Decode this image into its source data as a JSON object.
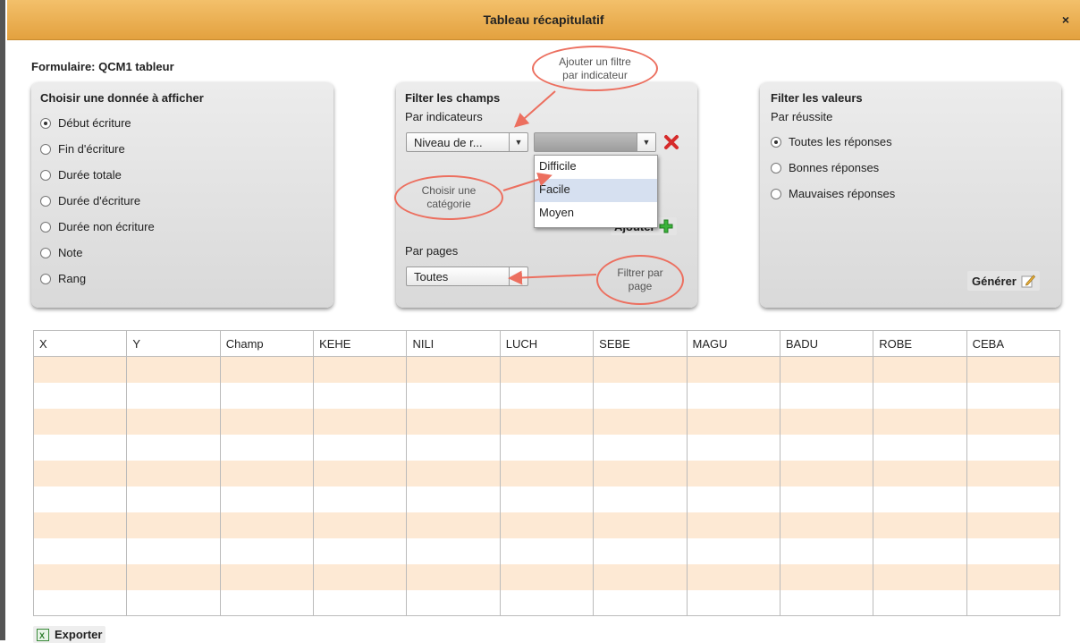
{
  "window": {
    "title": "Tableau récapitulatif",
    "close": "×"
  },
  "form_label": "Formulaire: QCM1 tableur",
  "data_panel": {
    "title": "Choisir une donnée à afficher",
    "options": [
      {
        "label": "Début écriture",
        "selected": true
      },
      {
        "label": "Fin d'écriture",
        "selected": false
      },
      {
        "label": "Durée totale",
        "selected": false
      },
      {
        "label": "Durée d'écriture",
        "selected": false
      },
      {
        "label": "Durée non écriture",
        "selected": false
      },
      {
        "label": "Note",
        "selected": false
      },
      {
        "label": "Rang",
        "selected": false
      }
    ]
  },
  "fields_panel": {
    "title": "Filter les champs",
    "by_indicators": "Par indicateurs",
    "indicator_select": "Niveau de r...",
    "value_select": "",
    "dropdown_options": [
      "Difficile",
      "Facile",
      "Moyen"
    ],
    "add_button": "Ajouter",
    "by_pages": "Par pages",
    "pages_select": "Toutes"
  },
  "values_panel": {
    "title": "Filter les valeurs",
    "subtitle": "Par réussite",
    "options": [
      {
        "label": "Toutes les réponses",
        "selected": true
      },
      {
        "label": "Bonnes réponses",
        "selected": false
      },
      {
        "label": "Mauvaises réponses",
        "selected": false
      }
    ],
    "generate_button": "Générer"
  },
  "annotations": {
    "add_filter": "Ajouter un filtre par indicateur",
    "choose_category": "Choisir une catégorie",
    "filter_page": "Filtrer par page"
  },
  "table": {
    "columns": [
      "X",
      "Y",
      "Champ",
      "KEHE",
      "NILI",
      "LUCH",
      "SEBE",
      "MAGU",
      "BADU",
      "ROBE",
      "CEBA"
    ]
  },
  "export_button": "Exporter",
  "colors": {
    "title_bar": "#e8a94a",
    "row_stripe": "#fde9d4",
    "annotation": "#ec6f5f",
    "add_icon": "#3bb33b",
    "remove_icon": "#d62b2b"
  }
}
